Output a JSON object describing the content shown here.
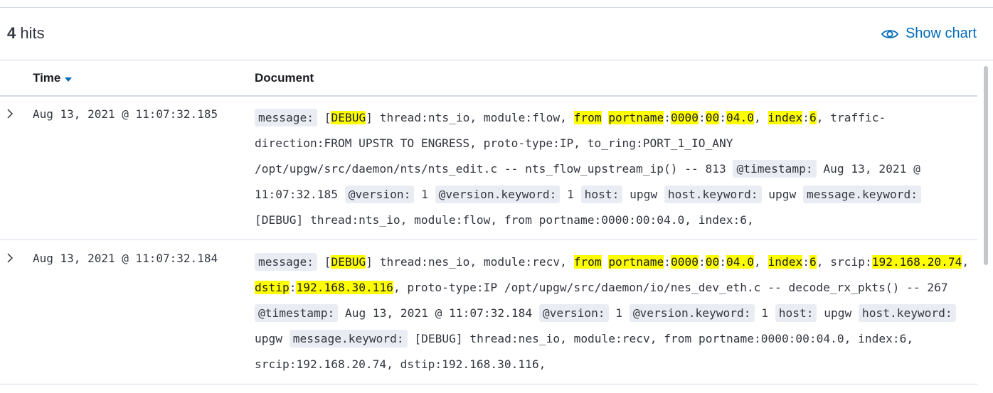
{
  "header": {
    "hits_count": "4",
    "hits_label": "hits",
    "show_chart_label": "Show chart",
    "show_chart_icon": "eye-icon"
  },
  "columns": {
    "time": "Time",
    "time_sort_icon": "sort-down-icon",
    "document": "Document"
  },
  "colors": {
    "accent": "#006bb8",
    "highlight": "#ffff00",
    "field_key_bg": "#e9edf3"
  },
  "rows": [
    {
      "time": "Aug 13, 2021 @ 11:07:32.185",
      "tokens": [
        {
          "k": "message:"
        },
        {
          "t": " ["
        },
        {
          "h": "DEBUG"
        },
        {
          "t": "] thread:nts_io, module:flow, "
        },
        {
          "h": "from"
        },
        {
          "t": " "
        },
        {
          "h": "portname"
        },
        {
          "t": ":"
        },
        {
          "h": "0000"
        },
        {
          "t": ":"
        },
        {
          "h": "00"
        },
        {
          "t": ":"
        },
        {
          "h": "04.0"
        },
        {
          "t": ", "
        },
        {
          "h": "index"
        },
        {
          "t": ":"
        },
        {
          "h": "6"
        },
        {
          "t": ", traffic-direction:FROM UPSTR TO ENGRESS, proto-type:IP, to_ring:PORT_1_IO_ANY /opt/upgw/src/daemon/nts/nts_edit.c -- nts_flow_upstream_ip() -- 813 "
        },
        {
          "k": "@timestamp:"
        },
        {
          "t": " Aug 13, 2021 @ 11:07:32.185 "
        },
        {
          "k": "@version:"
        },
        {
          "t": " 1 "
        },
        {
          "k": "@version.keyword:"
        },
        {
          "t": " 1 "
        },
        {
          "k": "host:"
        },
        {
          "t": " upgw "
        },
        {
          "k": "host.keyword:"
        },
        {
          "t": " upgw "
        },
        {
          "k": "message.keyword:"
        },
        {
          "t": " [DEBUG] thread:nts_io, module:flow, from portname:0000:00:04.0, index:6,"
        }
      ]
    },
    {
      "time": "Aug 13, 2021 @ 11:07:32.184",
      "tokens": [
        {
          "k": "message:"
        },
        {
          "t": " ["
        },
        {
          "h": "DEBUG"
        },
        {
          "t": "] thread:nes_io, module:recv, "
        },
        {
          "h": "from"
        },
        {
          "t": " "
        },
        {
          "h": "portname"
        },
        {
          "t": ":"
        },
        {
          "h": "0000"
        },
        {
          "t": ":"
        },
        {
          "h": "00"
        },
        {
          "t": ":"
        },
        {
          "h": "04.0"
        },
        {
          "t": ", "
        },
        {
          "h": "index"
        },
        {
          "t": ":"
        },
        {
          "h": "6"
        },
        {
          "t": ", srcip:"
        },
        {
          "h": "192.168.20.74"
        },
        {
          "t": ", "
        },
        {
          "h": "dstip"
        },
        {
          "t": ":"
        },
        {
          "h": "192.168.30.116"
        },
        {
          "t": ", proto-type:IP /opt/upgw/src/daemon/io/nes_dev_eth.c -- decode_rx_pkts() -- 267 "
        },
        {
          "k": "@timestamp:"
        },
        {
          "t": " Aug 13, 2021 @ 11:07:32.184 "
        },
        {
          "k": "@version:"
        },
        {
          "t": " 1 "
        },
        {
          "k": "@version.keyword:"
        },
        {
          "t": " 1 "
        },
        {
          "k": "host:"
        },
        {
          "t": " upgw "
        },
        {
          "k": "host.keyword:"
        },
        {
          "t": " upgw "
        },
        {
          "k": "message.keyword:"
        },
        {
          "t": " [DEBUG] thread:nes_io, module:recv, from portname:0000:00:04.0, index:6, srcip:192.168.20.74, dstip:192.168.30.116,"
        }
      ]
    }
  ]
}
